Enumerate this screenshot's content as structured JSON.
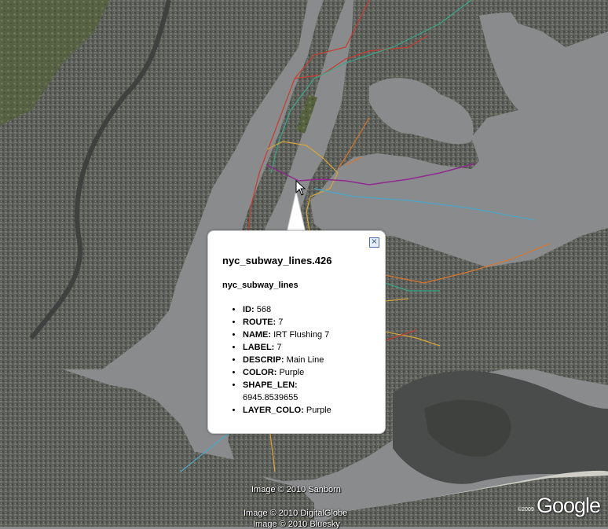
{
  "map": {
    "colors": {
      "water": "#8a8b8d",
      "urban": "#5f615c",
      "park": "#4f5b42",
      "route_red": "#c63d2f",
      "route_teal": "#3aa58a",
      "route_yellow": "#d7a53a",
      "route_orange": "#d8762d",
      "route_purple": "#8f2a8f",
      "route_cyan": "#4aa7c9"
    }
  },
  "popup": {
    "title": "nyc_subway_lines.426",
    "subtitle": "nyc_subway_lines",
    "close_icon": "close-x-icon",
    "fields": [
      {
        "key": "ID:",
        "value": " 568"
      },
      {
        "key": "ROUTE:",
        "value": " 7"
      },
      {
        "key": "NAME:",
        "value": " IRT Flushing 7"
      },
      {
        "key": "LABEL:",
        "value": " 7"
      },
      {
        "key": "DESCRIP:",
        "value": " Main Line"
      },
      {
        "key": "COLOR:",
        "value": " Purple"
      },
      {
        "key": "SHAPE_LEN:",
        "value": " 6945.8539655"
      },
      {
        "key": "LAYER_COLO:",
        "value": " Purple"
      }
    ]
  },
  "attribution": {
    "line1": "Image © 2010 Sanborn",
    "line2": "Image © 2010 DigitalGlobe",
    "line3": "Image © 2010 Bluesky"
  },
  "logo": {
    "text": "Google",
    "year": "©2009"
  }
}
